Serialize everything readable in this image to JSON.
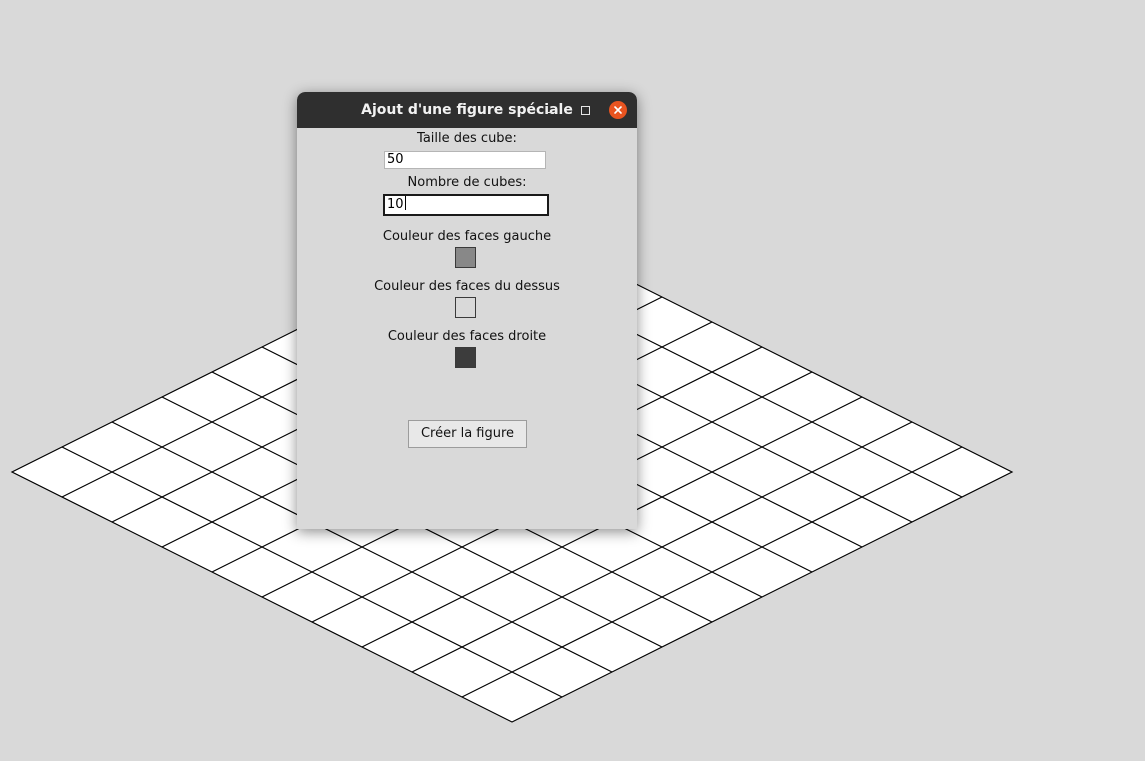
{
  "window": {
    "title": "Ajout d'une figure spéciale",
    "controls": [
      "minimize-icon",
      "maximize-icon",
      "close-icon"
    ]
  },
  "form": {
    "size_label": "Taille des cube:",
    "size_value": "50",
    "count_label": "Nombre de cubes:",
    "count_value": "10",
    "left_color_label": "Couleur des faces gauche",
    "left_color": "#888888",
    "top_color_label": "Couleur des faces du dessus",
    "top_color": "#d9d9d9",
    "right_color_label": "Couleur des faces droite",
    "right_color": "#3c3c3c",
    "create_button": "Créer la figure"
  },
  "canvas": {
    "background": "#d9d9d9",
    "grid_rows": 10,
    "grid_cols": 10,
    "tile_fill": "#ffffff",
    "line_color": "#000000"
  },
  "colors": {
    "titlebar": "#2f2f2f",
    "close_button": "#e95420",
    "dialog_bg": "#d9d9d9"
  }
}
